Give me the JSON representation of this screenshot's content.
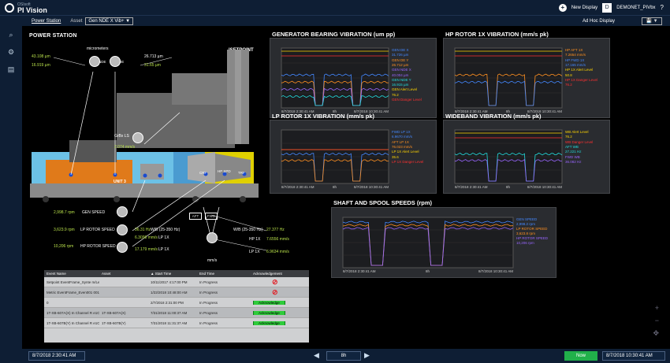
{
  "app": {
    "brand_small": "OSIsoft",
    "brand": "PI Vision",
    "new_display": "New Display",
    "user": "DEMONET_PIVbx"
  },
  "subbar": {
    "display_name": "Power Station",
    "asset_label": "Asset",
    "asset_value": "Gen NDE X Vib+ ▼",
    "adhoc": "Ad Hoc Display",
    "save": "💾 ▼"
  },
  "diagram": {
    "title": "POWER STATION",
    "micrometers": "micrometers",
    "brand": "ISETPOINT",
    "gen_nde": "GEN NDE",
    "gen_de": "GEN DE",
    "gen_nde_y": "43.108 µm",
    "gen_nde_x": "16.919 µm",
    "gen_de_y": "26.713 µm",
    "gen_de_x": "31.65 µm",
    "gearbox_ls": "GrBx LS",
    "gearbox_val": "2.074 mm/s",
    "unit": "UNIT 3",
    "gen_speed_val": "2,998.7 rpm",
    "gen_speed_lbl": "GEN SPEED",
    "lp_rotor_val": "3,623.9 rpm",
    "lp_rotor_lbl": "LP ROTOR SPEED",
    "hp_rotor_val": "10,206 rpm",
    "hp_rotor_lbl": "HP ROTOR SPEED",
    "wb_val": "36.31 Hz",
    "wb_lbl": "W/B (25-350 Hz)",
    "lp1x_val": "6.3098 mm/s",
    "lp1x_lbl": "LP 1X",
    "hp1x_val": "17.179 mm/s",
    "hp1x_lbl": "LP 1X",
    "wb2_lbl": "W/B (25-350 Hz)",
    "wb2_val": "27.377 Hz",
    "hp1x2_lbl": "HP 1X",
    "hp1x2_val": "7.6556 mm/s",
    "lp1x2_lbl": "LP 1X",
    "lp1x2_val": "6.9634 mm/s",
    "aft": "AFT",
    "fwd": "FWD",
    "mms": "mm/s",
    "crf": "CRF",
    "hp_spd": "HP SPD",
    "trf": "TRF"
  },
  "trends": [
    {
      "title": "GENERATOR BEARING VIBRATION (um pp)",
      "start": "8/7/2018 2:30:41 AM",
      "mid": "8h",
      "end": "8/7/2018 10:30:41 AM",
      "legend": [
        {
          "text": "GEN DE X",
          "color": "#4488ff"
        },
        {
          "text": "31.726 µm",
          "color": "#4488ff"
        },
        {
          "text": "GEN DE Y",
          "color": "#ff9020"
        },
        {
          "text": "26.712 µm",
          "color": "#ff9020"
        },
        {
          "text": "GEN NDE X",
          "color": "#9966ff"
        },
        {
          "text": "40.004 µm",
          "color": "#9966ff"
        },
        {
          "text": "GEN NDE Y",
          "color": "#22dddd"
        },
        {
          "text": "16.915 µm",
          "color": "#22dddd"
        },
        {
          "text": "GEN Alert Level",
          "color": "#ffd500"
        },
        {
          "text": "76.2",
          "color": "#ffd500"
        },
        {
          "text": "GEN Danger Level",
          "color": "#ff3030"
        }
      ]
    },
    {
      "title": "HP ROTOR 1X VIBRATION (mm/s pk)",
      "start": "8/7/2018 2:30:41 AM",
      "mid": "8h",
      "end": "8/7/2018 10:30:41 AM",
      "legend": [
        {
          "text": "HP AFT 1X",
          "color": "#ff9020"
        },
        {
          "text": "7.2654 mm/s",
          "color": "#ff9020"
        },
        {
          "text": "HP FWD 1X",
          "color": "#4488ff"
        },
        {
          "text": "17.165 mm/s",
          "color": "#4488ff"
        },
        {
          "text": "HP 1X Alert Level",
          "color": "#ffd500"
        },
        {
          "text": "50.8",
          "color": "#ffd500"
        },
        {
          "text": "HP 1X Danger Level",
          "color": "#ff3030"
        },
        {
          "text": "76.2",
          "color": "#ff3030"
        }
      ]
    },
    {
      "title": "LP ROTOR 1X VIBRATION (mm/s pk)",
      "start": "8/7/2018 2:30:41 AM",
      "mid": "8h",
      "end": "8/7/2018 10:30:41 AM",
      "legend": [
        {
          "text": "FWD LP 1X",
          "color": "#4488ff"
        },
        {
          "text": "6.9670 mm/s",
          "color": "#4488ff"
        },
        {
          "text": "AFT LP 1X",
          "color": "#ff9020"
        },
        {
          "text": "76.023 mm/s",
          "color": "#ff9020"
        },
        {
          "text": "LP 1X Alert Level",
          "color": "#ffd500"
        },
        {
          "text": "35.6",
          "color": "#ffd500"
        },
        {
          "text": "LP 1X Danger Level",
          "color": "#ff3030"
        }
      ]
    },
    {
      "title": "WIDEBAND VIBRATION (mm/s pk)",
      "start": "8/7/2018 2:30:41 AM",
      "mid": "8h",
      "end": "8/7/2018 10:30:41 AM",
      "legend": [
        {
          "text": "WB Alert Level",
          "color": "#ffd500"
        },
        {
          "text": "76.2",
          "color": "#ffd500"
        },
        {
          "text": "WB Danger Level",
          "color": "#ff3030"
        },
        {
          "text": "AFT WB",
          "color": "#22dddd"
        },
        {
          "text": "27.221 Hz",
          "color": "#22dddd"
        },
        {
          "text": "FWD WB",
          "color": "#9966ff"
        },
        {
          "text": "36.082 Hz",
          "color": "#9966ff"
        }
      ]
    },
    {
      "title": "SHAFT AND SPOOL SPEEDS (rpm)",
      "start": "8/7/2018 2:30:41 AM",
      "mid": "8h",
      "end": "8/7/2018 10:30:41 AM",
      "legend": [
        {
          "text": "GEN SPEED",
          "color": "#4488ff"
        },
        {
          "text": "2,998.2 rpm",
          "color": "#4488ff"
        },
        {
          "text": "LP ROTOR SPEED",
          "color": "#ff9020"
        },
        {
          "text": "3,623.8 rpm",
          "color": "#ff9020"
        },
        {
          "text": "HP ROTOR SPEED",
          "color": "#9966ff"
        },
        {
          "text": "10,206 rpm",
          "color": "#9966ff"
        }
      ]
    }
  ],
  "events": {
    "headers": [
      "Event Name",
      "Asset",
      "▲ Start Time",
      "End Time",
      "Acknowledgement"
    ],
    "rows": [
      {
        "name": "Setpoint EventFrame_Synte m/Less2017/10/001",
        "asset": "",
        "start": "10/11/2017 4:17:00 PM",
        "end": "In Progress",
        "ack": "none"
      },
      {
        "name": "Metric EventFrame_Even001 00122-001",
        "asset": "",
        "start": "1/22/2018 10:48:00 AM",
        "end": "In Progress",
        "ack": "none"
      },
      {
        "name": "0",
        "asset": "",
        "start": "2/7/2018 2:31:00 PM",
        "end": "In Progress",
        "ack": "Acknowledge"
      },
      {
        "name": "1T-XB-607A(X) In Channel R e1Ot",
        "asset": "1T-XB-607A(X)",
        "start": "7/31/2018 11:00:37 AM",
        "end": "In Progress",
        "ack": "Acknowledge"
      },
      {
        "name": "1T-XB-607B(Y) In Channel R e1Ot",
        "asset": "1T-XB-607B(Y)",
        "start": "7/31/2018 11:31:37 AM",
        "end": "In Progress",
        "ack": "Acknowledge"
      }
    ]
  },
  "bottom": {
    "start": "8/7/2018 2:30:41 AM",
    "duration": "8h",
    "now": "Now",
    "end": "8/7/2018 10:30:41 AM"
  }
}
